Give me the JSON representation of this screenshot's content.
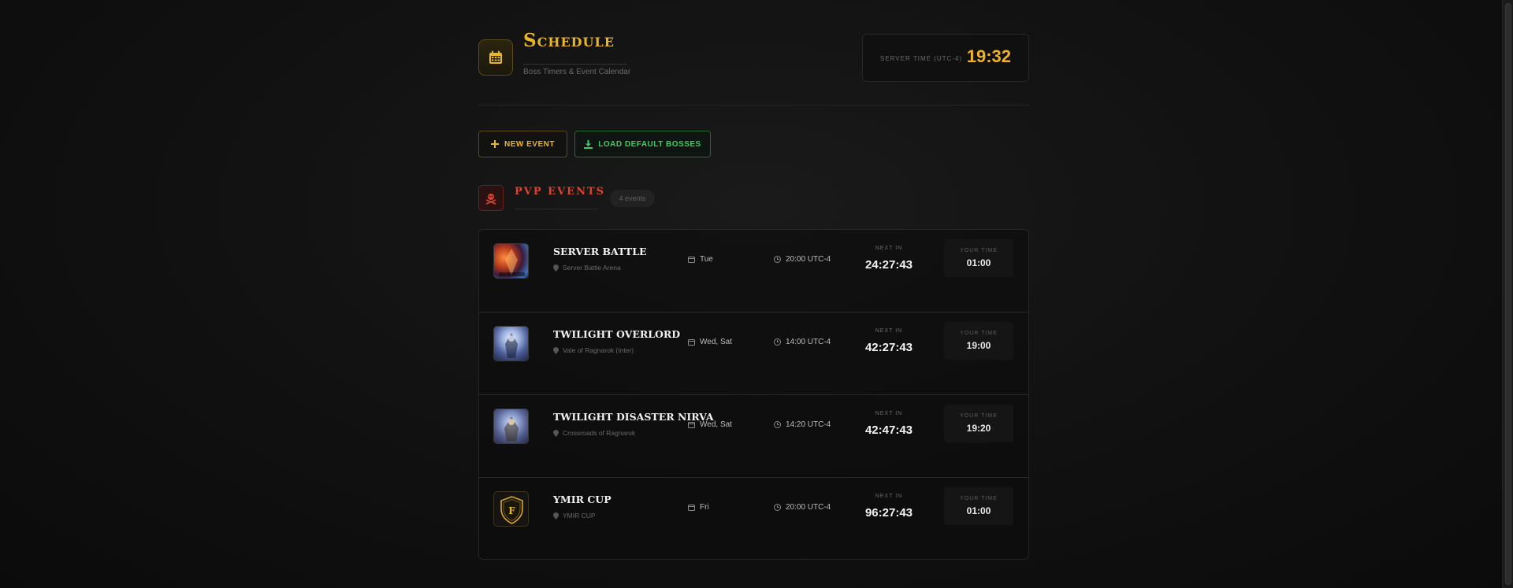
{
  "header": {
    "title": "Schedule",
    "subtitle": "Boss Timers & Event Calendar",
    "server_time_label": "SERVER TIME (UTC-4)",
    "server_time": "19:32"
  },
  "actions": {
    "new_event": "NEW EVENT",
    "load_default_bosses": "LOAD DEFAULT BOSSES"
  },
  "section": {
    "title": "PVP EVENTS",
    "count": "4 events"
  },
  "labels": {
    "next_in": "NEXT IN",
    "your_time": "YOUR TIME"
  },
  "events": [
    {
      "name": "SERVER BATTLE",
      "location": "Server Battle Arena",
      "days": "Tue",
      "time": "20:00 UTC-4",
      "next_in": "24:27:43",
      "your_time": "01:00",
      "icon": "server-battle-thumbnail"
    },
    {
      "name": "TWILIGHT OVERLORD",
      "location": "Vale of Ragnarok (Inter)",
      "days": "Wed, Sat",
      "time": "14:00 UTC-4",
      "next_in": "42:27:43",
      "your_time": "19:00",
      "icon": "twilight-overlord-thumbnail"
    },
    {
      "name": "TWILIGHT DISASTER NIRVA",
      "location": "Crossroads of Ragnarok",
      "days": "Wed, Sat",
      "time": "14:20 UTC-4",
      "next_in": "42:47:43",
      "your_time": "19:20",
      "icon": "twilight-disaster-thumbnail"
    },
    {
      "name": "YMIR CUP",
      "location": "YMIR CUP",
      "days": "Fri",
      "time": "20:00 UTC-4",
      "next_in": "96:27:43",
      "your_time": "01:00",
      "icon": "shield-emblem",
      "emblem_letter": "F"
    }
  ],
  "colors": {
    "accent_gold": "#e8b62c",
    "accent_green": "#3fcc66",
    "accent_red": "#d9452e",
    "background": "#121212"
  }
}
